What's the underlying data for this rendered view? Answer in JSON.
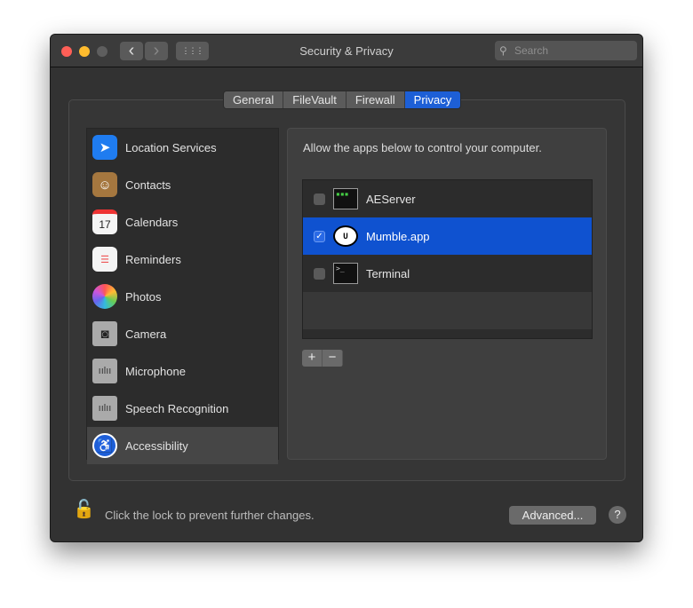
{
  "window": {
    "title": "Security & Privacy",
    "search_placeholder": "Search",
    "back": "‹",
    "forward": "›",
    "grid": "⋮⋮⋮"
  },
  "tabs": [
    {
      "label": "General"
    },
    {
      "label": "FileVault"
    },
    {
      "label": "Firewall"
    },
    {
      "label": "Privacy",
      "active": true
    }
  ],
  "sidebar": {
    "items": [
      {
        "label": "Location Services",
        "icon": "location-arrow-icon"
      },
      {
        "label": "Contacts",
        "icon": "contacts-book-icon"
      },
      {
        "label": "Calendars",
        "icon": "calendar-icon"
      },
      {
        "label": "Reminders",
        "icon": "reminders-list-icon"
      },
      {
        "label": "Photos",
        "icon": "photos-flower-icon"
      },
      {
        "label": "Camera",
        "icon": "camera-icon"
      },
      {
        "label": "Microphone",
        "icon": "microphone-waveform-icon"
      },
      {
        "label": "Speech Recognition",
        "icon": "speech-waveform-icon"
      },
      {
        "label": "Accessibility",
        "icon": "accessibility-icon",
        "selected": true
      }
    ]
  },
  "main": {
    "description": "Allow the apps below to control your computer.",
    "apps": [
      {
        "name": "AEServer",
        "checked": false
      },
      {
        "name": "Mumble.app",
        "checked": true
      },
      {
        "name": "Terminal",
        "checked": false
      }
    ],
    "add": "+",
    "remove": "−"
  },
  "footer": {
    "lock_text": "Click the lock to prevent further changes.",
    "advanced": "Advanced...",
    "help": "?"
  },
  "colors": {
    "accent": "#1d5fd6",
    "selected_row": "#0f52d0"
  }
}
